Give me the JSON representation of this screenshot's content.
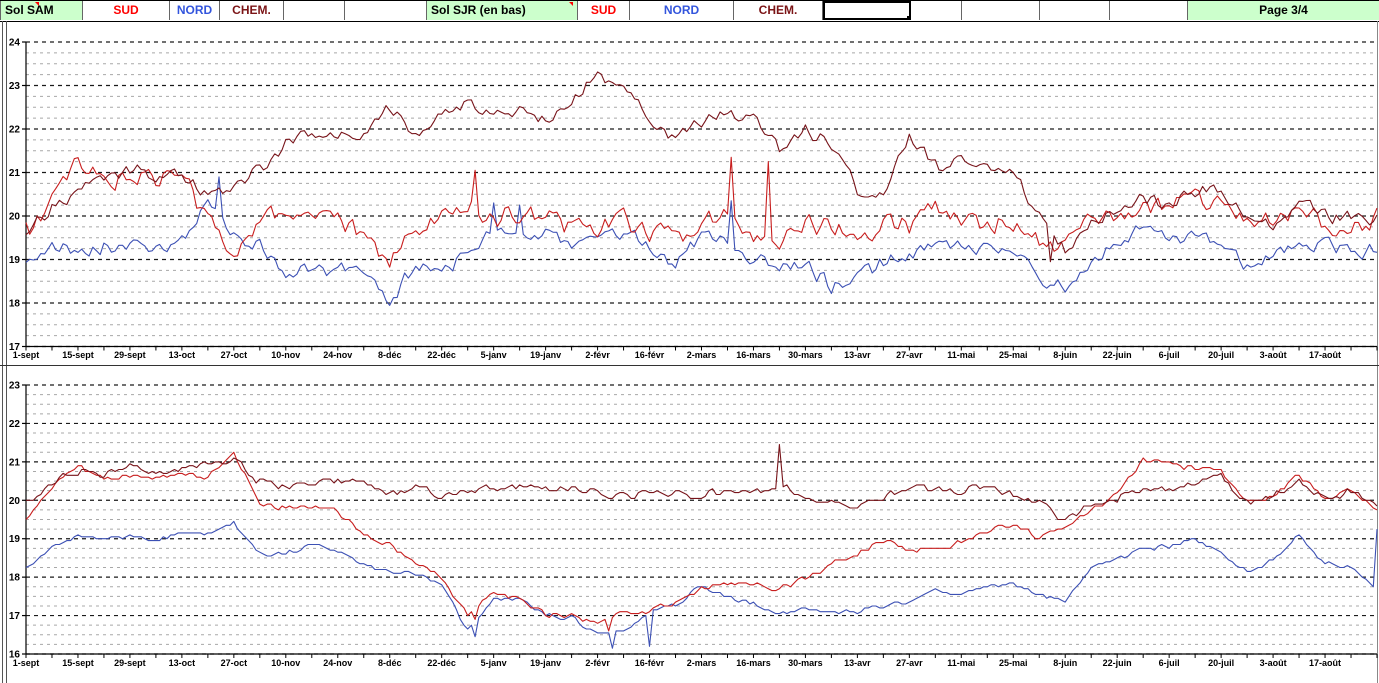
{
  "header": {
    "sam_title": "Sol SAM",
    "sjr_title": "Sol SJR  (en bas)",
    "sud_label": "SUD",
    "nord_label": "NORD",
    "chem_label": "CHEM.",
    "page_label": "Page  3/4",
    "colors": {
      "title_bg": "#ccffcc",
      "sud": "#ff0000",
      "nord": "#3355dd",
      "chem": "#7b1416"
    }
  },
  "chart_data": [
    {
      "id": "sol-sam",
      "type": "line",
      "title": "Sol SAM",
      "ylim": [
        17,
        24
      ],
      "yticks": [
        24,
        23,
        22,
        21,
        20,
        19,
        18,
        17
      ],
      "grid": {
        "major_step": 1,
        "minor_step": 0.25,
        "major_color": "#1a1a1a",
        "minor_color": "#a8a8a8"
      },
      "days": 365,
      "x_tick_interval_days": 14,
      "x_tick_labels": [
        "1-sept",
        "15-sept",
        "29-sept",
        "13-oct",
        "27-oct",
        "10-nov",
        "24-nov",
        "8-déc",
        "22-déc",
        "5-janv",
        "19-janv",
        "2-févr",
        "16-févr",
        "2-mars",
        "16-mars",
        "30-mars",
        "13-avr",
        "27-avr",
        "11-mai",
        "25-mai",
        "8-juin",
        "22-juin",
        "6-juil",
        "20-juil",
        "3-août",
        "17-août"
      ],
      "series": [
        {
          "name": "NORD",
          "color": "#3c50b4",
          "noise": 0.22,
          "seed": 7,
          "quantize": 0,
          "weekly_values": [
            19.0,
            19.25,
            19.2,
            19.3,
            19.3,
            19.25,
            19.4,
            20.3,
            19.6,
            19.3,
            18.7,
            18.7,
            18.75,
            18.8,
            18.0,
            18.85,
            18.7,
            19.2,
            19.7,
            19.5,
            19.6,
            19.35,
            19.5,
            19.6,
            19.3,
            18.9,
            19.5,
            19.4,
            19.0,
            18.9,
            18.9,
            18.4,
            18.6,
            18.9,
            19.1,
            19.3,
            19.3,
            19.25,
            19.1,
            18.6,
            18.4,
            19.0,
            19.3,
            19.7,
            19.45,
            19.5,
            19.4,
            18.9,
            19.1,
            19.35,
            19.4,
            19.2,
            19.2
          ],
          "events": {
            "52": 20.9,
            "126": 20.3,
            "133": 20.25,
            "190": 20.35
          }
        },
        {
          "name": "SUD",
          "color": "#c81e1e",
          "noise": 0.3,
          "seed": 3,
          "quantize": 0,
          "weekly_values": [
            19.6,
            20.3,
            21.2,
            20.8,
            20.9,
            20.85,
            20.95,
            19.9,
            19.2,
            19.9,
            20.1,
            20.05,
            19.9,
            19.5,
            19.0,
            19.6,
            20.0,
            20.3,
            19.9,
            20.1,
            19.9,
            19.8,
            19.7,
            19.9,
            19.7,
            19.5,
            19.85,
            20.0,
            19.6,
            19.5,
            19.8,
            19.8,
            19.4,
            19.9,
            19.8,
            20.2,
            20.0,
            19.8,
            19.9,
            19.4,
            19.2,
            19.9,
            19.9,
            20.15,
            20.35,
            20.4,
            20.4,
            19.9,
            19.9,
            20.3,
            19.7,
            19.6,
            19.95
          ],
          "events": {
            "121": 21.05,
            "190": 21.35,
            "200": 21.25
          }
        },
        {
          "name": "CHEM.",
          "color": "#78141a",
          "noise": 0.2,
          "seed": 11,
          "quantize": 0,
          "weekly_values": [
            19.6,
            20.2,
            20.6,
            20.8,
            21.05,
            20.9,
            20.9,
            20.45,
            20.7,
            21.05,
            21.65,
            21.9,
            21.95,
            21.85,
            22.5,
            21.9,
            22.3,
            22.6,
            22.3,
            22.4,
            22.25,
            22.65,
            23.25,
            23.0,
            22.25,
            21.75,
            22.15,
            22.4,
            22.2,
            21.5,
            22.0,
            21.7,
            20.6,
            20.5,
            21.85,
            21.1,
            21.25,
            21.2,
            20.95,
            20.0,
            19.2,
            19.9,
            20.1,
            20.4,
            20.3,
            20.55,
            20.6,
            20.1,
            19.8,
            20.3,
            20.0,
            19.9,
            19.95
          ],
          "events": {
            "276": 18.95
          }
        }
      ]
    },
    {
      "id": "sol-sjr",
      "type": "line",
      "title": "Sol SJR (en bas)",
      "ylim": [
        16,
        23
      ],
      "yticks": [
        23,
        22,
        21,
        20,
        19,
        18,
        17,
        16
      ],
      "grid": {
        "major_step": 1,
        "minor_step": 0.25,
        "major_color": "#1a1a1a",
        "minor_color": "#a8a8a8"
      },
      "days": 365,
      "x_tick_interval_days": 14,
      "x_tick_labels": [
        "1-sept",
        "15-sept",
        "29-sept",
        "13-oct",
        "27-oct",
        "10-nov",
        "24-nov",
        "8-déc",
        "22-déc",
        "5-janv",
        "19-janv",
        "2-févr",
        "16-févr",
        "2-mars",
        "16-mars",
        "30-mars",
        "13-avr",
        "27-avr",
        "11-mai",
        "25-mai",
        "8-juin",
        "22-juin",
        "6-juil",
        "20-juil",
        "3-août",
        "17-août"
      ],
      "series": [
        {
          "name": "NORD",
          "color": "#3c50b4",
          "noise": 0.07,
          "seed": 21,
          "quantize": 0.05,
          "weekly_values": [
            18.2,
            18.8,
            19.05,
            19.0,
            19.05,
            19.0,
            19.1,
            19.15,
            19.4,
            18.6,
            18.6,
            18.85,
            18.7,
            18.3,
            18.15,
            18.1,
            17.8,
            16.6,
            17.45,
            17.4,
            17.0,
            16.95,
            16.5,
            16.6,
            17.1,
            17.3,
            17.8,
            17.5,
            17.3,
            17.05,
            17.2,
            17.05,
            17.1,
            17.25,
            17.35,
            17.65,
            17.55,
            17.8,
            17.8,
            17.55,
            17.35,
            18.25,
            18.45,
            18.75,
            18.8,
            19.0,
            18.6,
            18.15,
            18.4,
            19.1,
            18.35,
            18.25,
            17.75
          ],
          "events": {
            "121": 16.45,
            "158": 16.15,
            "168": 16.2,
            "364": 19.25
          }
        },
        {
          "name": "SUD",
          "color": "#c81e1e",
          "noise": 0.09,
          "seed": 17,
          "quantize": 0.05,
          "weekly_values": [
            19.5,
            20.35,
            20.9,
            20.55,
            20.65,
            20.55,
            20.7,
            20.6,
            21.2,
            19.9,
            19.8,
            19.9,
            19.7,
            19.1,
            18.85,
            18.4,
            18.0,
            17.0,
            17.6,
            17.4,
            17.05,
            17.0,
            16.8,
            17.1,
            17.1,
            17.4,
            17.7,
            17.85,
            17.85,
            17.7,
            17.95,
            18.35,
            18.6,
            18.95,
            18.7,
            18.75,
            18.9,
            19.2,
            19.4,
            19.0,
            19.3,
            19.7,
            20.2,
            21.05,
            20.9,
            20.85,
            20.75,
            19.95,
            20.1,
            20.7,
            20.05,
            20.3,
            19.75
          ],
          "events": {
            "119": 17.0,
            "121": 16.9,
            "157": 16.6
          }
        },
        {
          "name": "CHEM.",
          "color": "#78141a",
          "noise": 0.13,
          "seed": 29,
          "quantize": 0.05,
          "weekly_values": [
            19.95,
            20.5,
            20.75,
            20.7,
            20.9,
            20.7,
            20.85,
            20.9,
            21.05,
            20.5,
            20.35,
            20.5,
            20.5,
            20.4,
            20.1,
            20.4,
            20.1,
            20.3,
            20.3,
            20.4,
            20.3,
            20.3,
            20.25,
            20.1,
            20.2,
            20.2,
            20.1,
            20.25,
            20.2,
            20.4,
            20.1,
            20.0,
            19.85,
            20.1,
            20.3,
            20.3,
            20.2,
            20.4,
            20.15,
            19.9,
            19.45,
            19.85,
            20.05,
            20.3,
            20.25,
            20.4,
            20.6,
            19.95,
            20.1,
            20.5,
            20.0,
            20.2,
            19.85
          ],
          "events": {
            "203": 21.45
          }
        }
      ]
    }
  ]
}
